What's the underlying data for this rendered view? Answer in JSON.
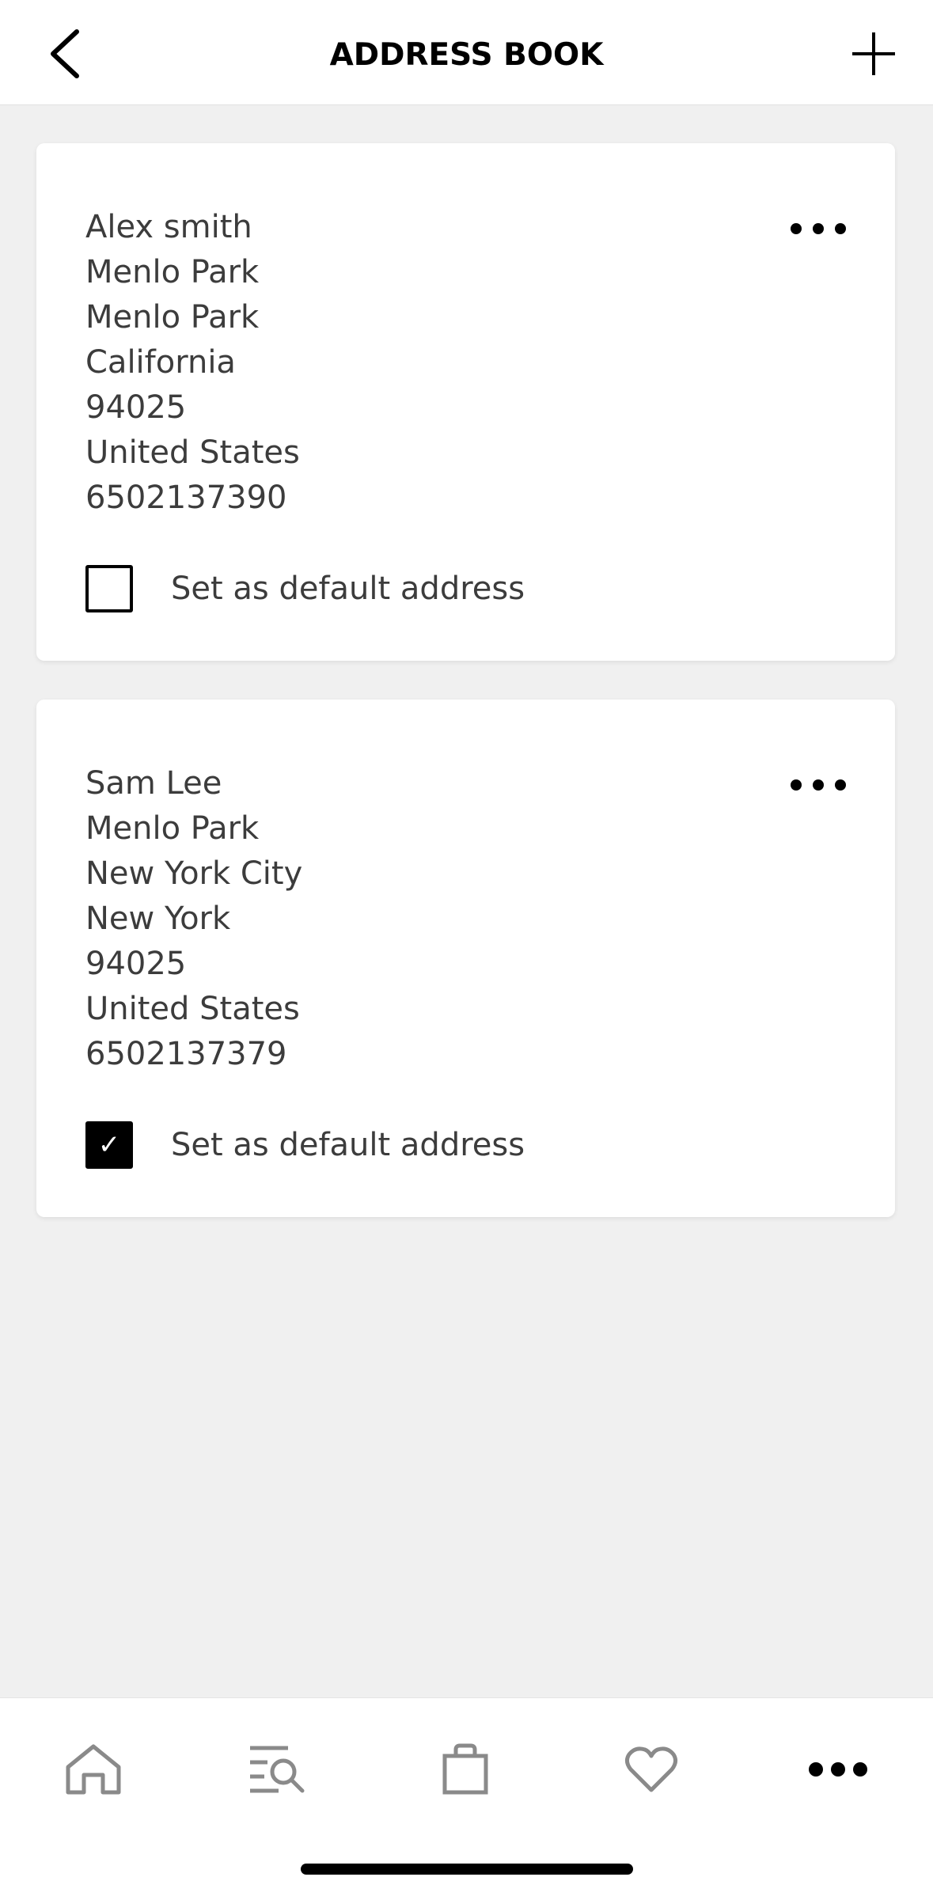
{
  "header": {
    "title": "ADDRESS BOOK",
    "back_icon": "chevron-left-icon",
    "add_icon": "plus-icon"
  },
  "addresses": [
    {
      "name": "Alex smith",
      "line1": "Menlo Park",
      "city": "Menlo Park",
      "state": "California",
      "zip": "94025",
      "country": "United States",
      "phone": "6502137390",
      "default_label": "Set as default address",
      "is_default": false
    },
    {
      "name": "Sam Lee",
      "line1": "Menlo Park",
      "city": "New York City",
      "state": "New York",
      "zip": "94025",
      "country": "United States",
      "phone": "6502137379",
      "default_label": "Set as default address",
      "is_default": true
    }
  ],
  "checkmark_glyph": "✓",
  "bottom_nav": {
    "items": [
      "home-icon",
      "search-list-icon",
      "shopping-bag-icon",
      "heart-icon",
      "more-icon"
    ],
    "active": "more-icon",
    "inactive_color": "#8a8a8a",
    "active_color": "#000000"
  }
}
